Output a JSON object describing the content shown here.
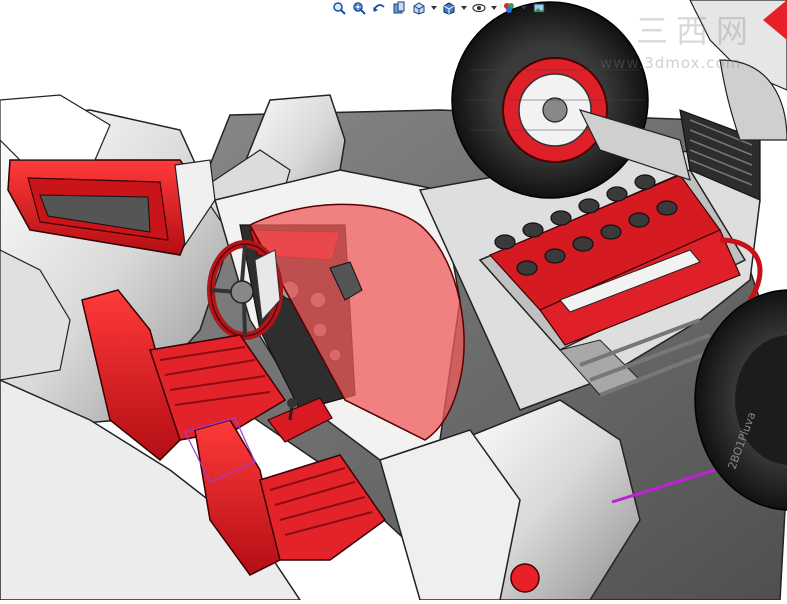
{
  "toolbar": {
    "buttons": [
      {
        "id": "zoom-to-fit",
        "icon": "zoom-to-fit-icon"
      },
      {
        "id": "zoom-to-area",
        "icon": "zoom-to-area-icon"
      },
      {
        "id": "previous-view",
        "icon": "previous-view-icon"
      },
      {
        "id": "section-view",
        "icon": "section-view-icon"
      },
      {
        "id": "dynamic-annotation",
        "icon": "view-orientation-icon"
      },
      {
        "id": "display-style",
        "icon": "display-style-icon"
      },
      {
        "id": "hide-show",
        "icon": "hide-show-items-icon"
      },
      {
        "id": "edit-appearance",
        "icon": "edit-appearance-icon"
      },
      {
        "id": "apply-scene",
        "icon": "apply-scene-icon"
      }
    ]
  },
  "watermark": {
    "chars": [
      "三",
      "西",
      "网"
    ],
    "url": "www.3dmox.com"
  },
  "model": {
    "tire_sidewall_text": "2BO1Pluva"
  },
  "colors": {
    "accent_red": "#e8202a",
    "dark_red": "#9b0d12",
    "body_white": "#efefef",
    "floor_gray": "#6a6a6a",
    "windshield": "#f28a8a",
    "highlight_magenta": "#c020d8"
  }
}
